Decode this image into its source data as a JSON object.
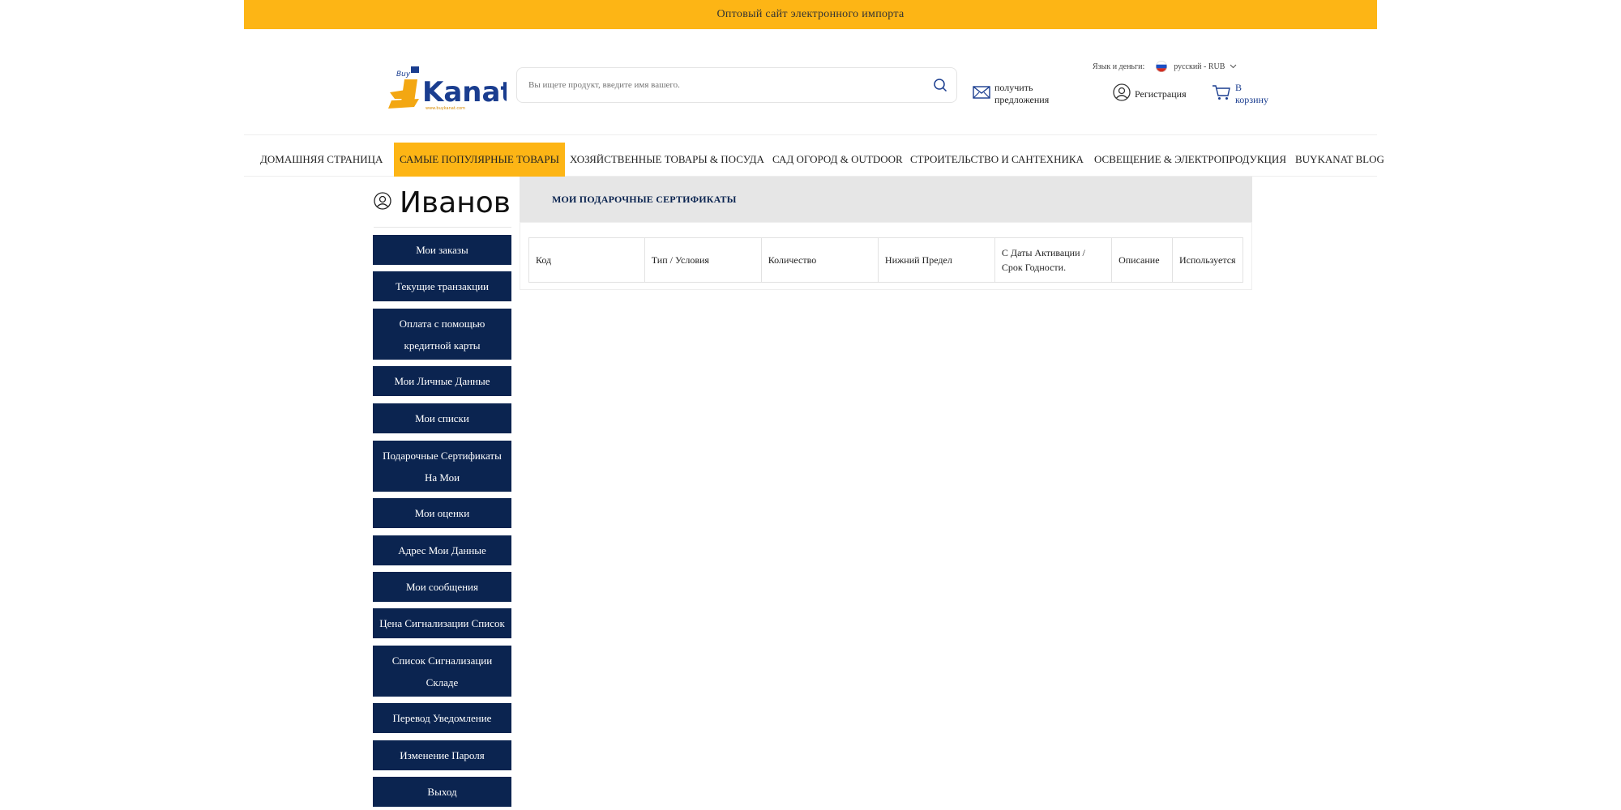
{
  "topbar": {
    "text": "Оптовый сайт электронного импорта"
  },
  "header": {
    "logo_text": "Kanat",
    "search": {
      "placeholder": "Вы ищете продукт, введите имя вашего."
    },
    "lang": {
      "label": "Язык и деньги:",
      "value": "русский - RUB"
    },
    "actions": {
      "offers": "получить предложения",
      "register": "Регистрация",
      "cart": "В корзину"
    }
  },
  "nav": {
    "items": [
      "ДОМАШНЯЯ СТРАНИЦА",
      "САМЫЕ ПОПУЛЯРНЫЕ ТОВАРЫ",
      "ХОЗЯЙСТВЕННЫЕ ТОВАРЫ & ПОСУДА",
      "САД ОГОРОД & OUTDOOR",
      "СТРОИТЕЛЬСТВО И САНТЕХНИКА",
      "ОСВЕЩЕНИЕ & ЭЛЕКТРОПРОДУКЦИЯ",
      "BUYKANAT BLOG"
    ],
    "active_index": 1
  },
  "user": {
    "name": "Иванов"
  },
  "sidebar": {
    "items": [
      "Мои заказы",
      "Текущие транзакции",
      "Оплата с помощью кредитной карты",
      "Мои Личные Данные",
      "Мои списки",
      "Подарочные Сертификаты На Мои",
      "Мои оценки",
      "Адрес Мои Данные",
      "Мои сообщения",
      "Цена Сигнализации Список",
      "Список Сигнализации Складе",
      "Перевод Уведомление",
      "Изменение Пароля",
      "Выход"
    ]
  },
  "panel": {
    "title": "МОИ ПОДАРОЧНЫЕ СЕРТИФИКАТЫ",
    "columns": [
      "Код",
      "Тип / Условия",
      "Количество",
      "Нижний Предел",
      "С Даты Активации / Срок Годности.",
      "Описание",
      "Используется"
    ]
  },
  "colors": {
    "accent": "#fdb515",
    "navy": "#0b2450",
    "panel_gray": "#e6e6e6"
  }
}
